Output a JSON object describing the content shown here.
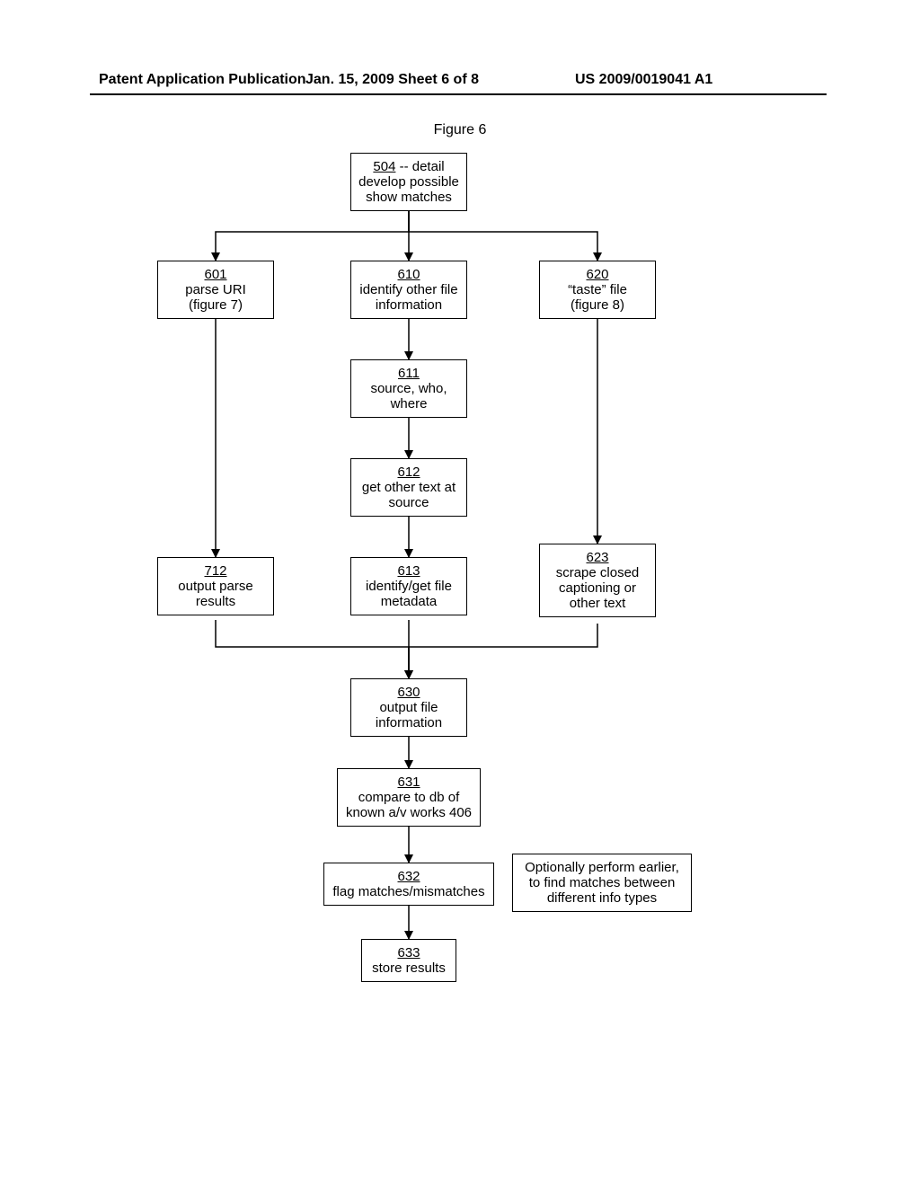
{
  "header": {
    "left": "Patent Application Publication",
    "mid": "Jan. 15, 2009   Sheet 6 of 8",
    "pub": "US 2009/0019041 A1"
  },
  "figure_title": "Figure 6",
  "boxes": {
    "b504": {
      "num": "504",
      "suffix": " -- detail",
      "body": "develop possible show matches"
    },
    "b601": {
      "num": "601",
      "body": "parse URI (figure 7)"
    },
    "b610": {
      "num": "610",
      "body": "identify other file information"
    },
    "b620": {
      "num": "620",
      "body": "“taste” file (figure 8)"
    },
    "b611": {
      "num": "611",
      "body": "source, who, where"
    },
    "b612": {
      "num": "612",
      "body": "get other text at source"
    },
    "b712": {
      "num": "712",
      "body": "output parse results"
    },
    "b613": {
      "num": "613",
      "body": "identify/get file metadata"
    },
    "b623": {
      "num": "623",
      "body": "scrape closed captioning or other text"
    },
    "b630": {
      "num": "630",
      "body": "output file information"
    },
    "b631": {
      "num": "631",
      "body": "compare to db of known a/v works 406"
    },
    "b632": {
      "num": "632",
      "body": "flag matches/mismatches"
    },
    "b633": {
      "num": "633",
      "body": "store results"
    },
    "note": {
      "body": "Optionally perform earlier, to find matches between different info types"
    }
  }
}
